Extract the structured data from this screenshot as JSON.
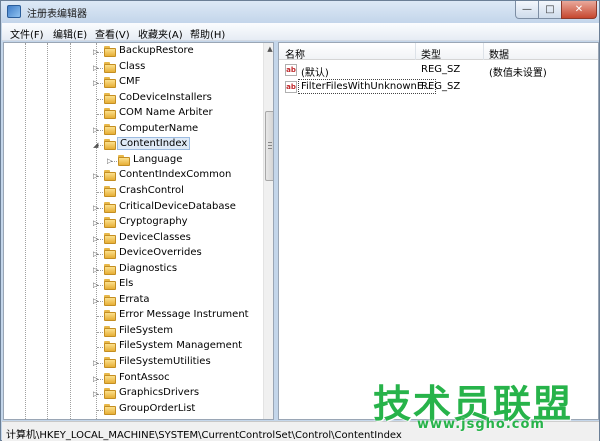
{
  "window": {
    "title": "注册表编辑器",
    "minimize_glyph": "—",
    "maximize_glyph": "□",
    "close_glyph": "✕"
  },
  "menu": [
    "文件(F)",
    "编辑(E)",
    "查看(V)",
    "收藏夹(A)",
    "帮助(H)"
  ],
  "tree": {
    "items": [
      {
        "label": "BackupRestore",
        "expandable": true
      },
      {
        "label": "Class",
        "expandable": true
      },
      {
        "label": "CMF",
        "expandable": true
      },
      {
        "label": "CoDeviceInstallers",
        "expandable": false
      },
      {
        "label": "COM Name Arbiter",
        "expandable": false
      },
      {
        "label": "ComputerName",
        "expandable": true
      },
      {
        "label": "ContentIndex",
        "expandable": true,
        "expanded": true,
        "selected": true
      },
      {
        "label": "Language",
        "expandable": true,
        "child": true
      },
      {
        "label": "ContentIndexCommon",
        "expandable": true
      },
      {
        "label": "CrashControl",
        "expandable": false
      },
      {
        "label": "CriticalDeviceDatabase",
        "expandable": true
      },
      {
        "label": "Cryptography",
        "expandable": true
      },
      {
        "label": "DeviceClasses",
        "expandable": true
      },
      {
        "label": "DeviceOverrides",
        "expandable": true
      },
      {
        "label": "Diagnostics",
        "expandable": true
      },
      {
        "label": "Els",
        "expandable": true
      },
      {
        "label": "Errata",
        "expandable": true
      },
      {
        "label": "Error Message Instrument",
        "expandable": false
      },
      {
        "label": "FileSystem",
        "expandable": false
      },
      {
        "label": "FileSystem Management",
        "expandable": false
      },
      {
        "label": "FileSystemUtilities",
        "expandable": true
      },
      {
        "label": "FontAssoc",
        "expandable": true
      },
      {
        "label": "GraphicsDrivers",
        "expandable": true
      },
      {
        "label": "GroupOrderList",
        "expandable": false
      }
    ]
  },
  "list": {
    "columns": [
      "名称",
      "类型",
      "数据"
    ],
    "rows": [
      {
        "icon": "ab",
        "name": "(默认)",
        "type": "REG_SZ",
        "data": "(数值未设置)"
      },
      {
        "icon": "ab",
        "name": "FilterFilesWithUnknownE...",
        "type": "REG_SZ",
        "data": ""
      }
    ]
  },
  "status": {
    "path": "计算机\\HKEY_LOCAL_MACHINE\\SYSTEM\\CurrentControlSet\\Control\\ContentIndex"
  },
  "watermark": {
    "logo": "技术员联盟",
    "url": "www.jsgho.com"
  },
  "colors": {
    "folder": "#e6ae36",
    "watermark": "#27b34a",
    "selection": "#dfeaf7"
  }
}
